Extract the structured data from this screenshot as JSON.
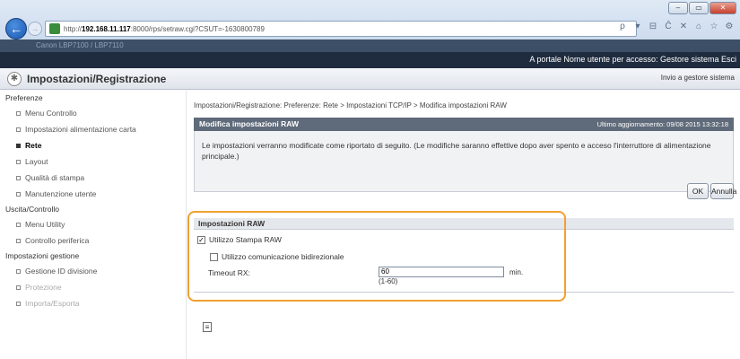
{
  "browser": {
    "window_buttons": [
      "–",
      "▭",
      "✕"
    ],
    "url_prefix": "http://",
    "url_host": "192.168.11.117",
    "url_rest": ":8000/rps/setraw.cgi?CSUT=-1630800789",
    "tools": [
      "ρ",
      "▾",
      "⊟",
      "Ĉ",
      "✕",
      "⌂",
      "☆",
      "⚙"
    ],
    "tab_text": "Canon   LBP7100 / LBP7110"
  },
  "app": {
    "banner_right": "A portale  Nome utente per accesso: Gestore sistema Esci",
    "title": "Impostazioni/Registrazione",
    "go_management": "Invio a gestore sistema"
  },
  "sidebar": {
    "sections": [
      {
        "label": "Preferenze",
        "items": [
          {
            "label": "Menu Controllo",
            "active": false
          },
          {
            "label": "Impostazioni alimentazione carta",
            "active": false
          },
          {
            "label": "Rete",
            "active": true
          },
          {
            "label": "Layout",
            "active": false
          },
          {
            "label": "Qualità di stampa",
            "active": false
          },
          {
            "label": "Manutenzione utente",
            "active": false
          }
        ]
      },
      {
        "label": "Uscita/Controllo",
        "items": [
          {
            "label": "Menu Utility",
            "active": false
          },
          {
            "label": "Controllo periferica",
            "active": false
          }
        ]
      },
      {
        "label": "Impostazioni gestione",
        "items": [
          {
            "label": "Gestione ID divisione",
            "active": false
          },
          {
            "label": "Protezione",
            "active": false
          },
          {
            "label": "Importa/Esporta",
            "active": false
          }
        ]
      }
    ]
  },
  "main": {
    "breadcrumb": "Impostazioni/Registrazione: Preferenze: Rete > Impostazioni TCP/IP > Modifica impostazioni RAW",
    "section_title": "Modifica impostazioni RAW",
    "last_updated": "Ultimo aggiornamento: 09/08 2015 13:32:18",
    "info_text": "Le impostazioni verranno modificate come riportato di seguito. (Le modifiche saranno effettive dopo aver spento e acceso l'interruttore di alimentazione principale.)",
    "ok_label": "OK",
    "cancel_label": "Annulla",
    "raw": {
      "header": "Impostazioni RAW",
      "use_raw_label": "Utilizzo Stampa RAW",
      "use_raw_checked": true,
      "bidir_label": "Utilizzo comunicazione bidirezionale",
      "bidir_checked": false,
      "timeout_label": "Timeout RX:",
      "timeout_value": "60",
      "timeout_unit": "min.",
      "timeout_range": "(1-60)"
    },
    "top_icon": "≡"
  },
  "colors": {
    "section_bar": "#5f6b7a",
    "banner": "#1f2c3f",
    "highlight": "#f0a030"
  }
}
